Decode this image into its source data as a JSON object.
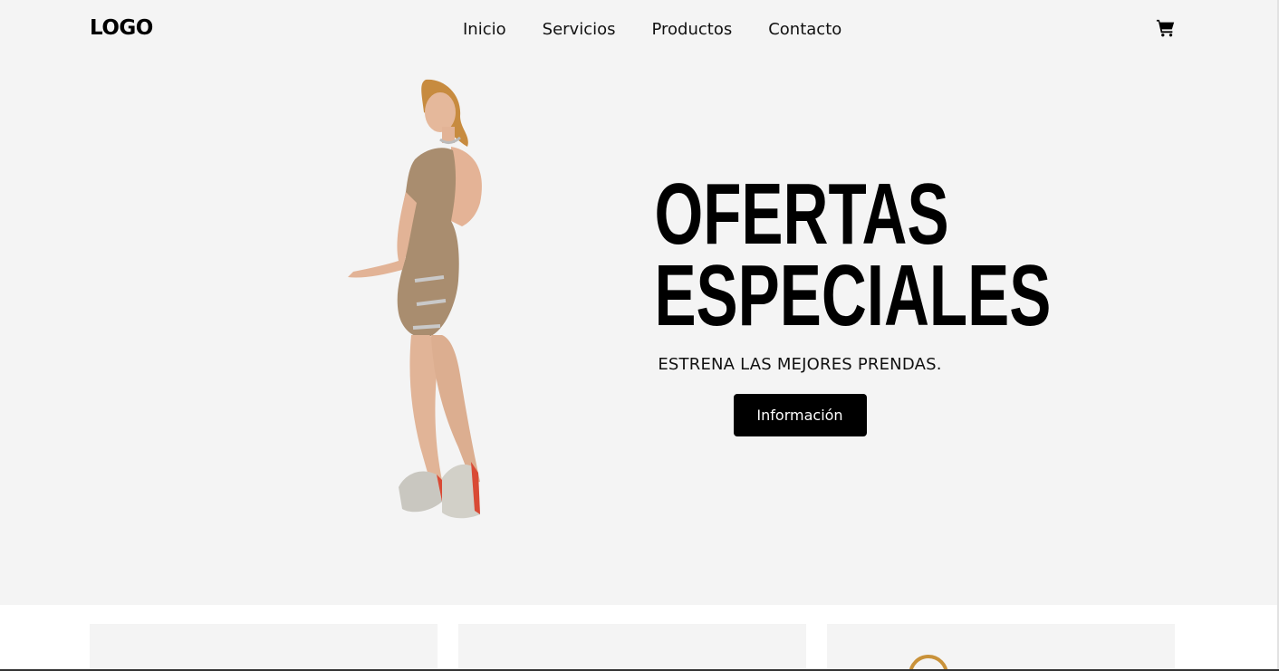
{
  "header": {
    "logo": "LOGO",
    "nav": [
      {
        "label": "Inicio"
      },
      {
        "label": "Servicios"
      },
      {
        "label": "Productos"
      },
      {
        "label": "Contacto"
      }
    ],
    "cart_icon": "shopping-cart-icon"
  },
  "hero": {
    "title_line1": "OFERTAS",
    "title_line2": "ESPECIALES",
    "subtitle": "ESTRENA LAS MEJORES PRENDAS.",
    "button_label": "Información",
    "background_color": "#f4f4f4",
    "button_color": "#000000"
  },
  "products": [
    {
      "image": "product-image"
    },
    {
      "image": "product-image"
    },
    {
      "image": "product-image-ring"
    }
  ]
}
